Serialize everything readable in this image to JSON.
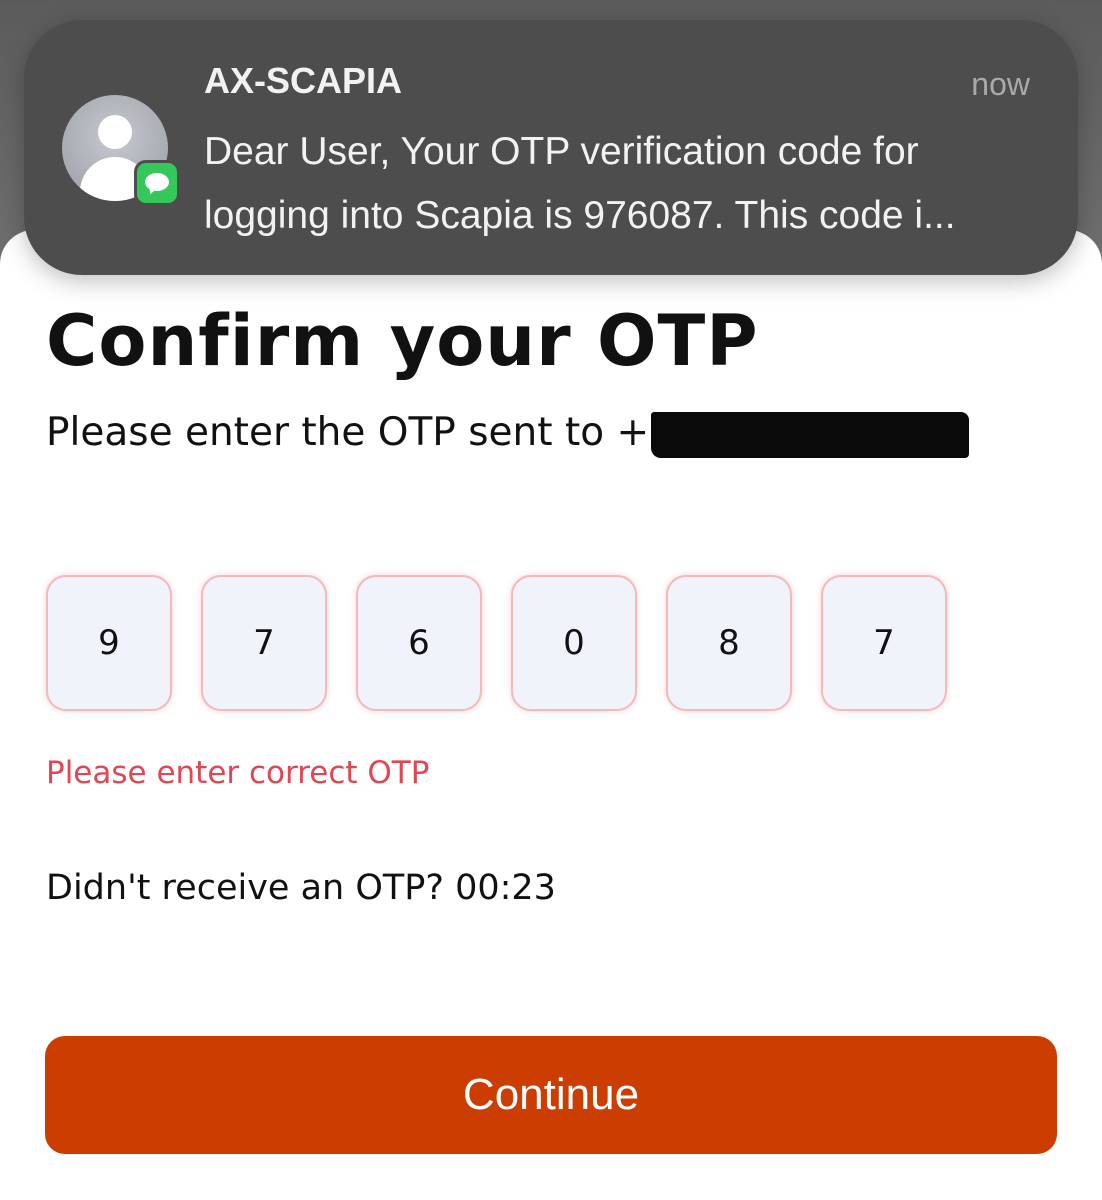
{
  "notification": {
    "sender": "AX-SCAPIA",
    "time": "now",
    "line1": "Dear User, Your OTP verification code for",
    "line2": "logging into Scapia is 976087. This code i..."
  },
  "page": {
    "title": "Confirm your OTP",
    "subtitle_prefix": "Please enter the OTP sent to +",
    "otp_digits": [
      "9",
      "7",
      "6",
      "0",
      "8",
      "7"
    ],
    "error_message": "Please enter correct OTP",
    "resend_text": "Didn't receive an OTP? 00:23",
    "continue_label": "Continue"
  },
  "colors": {
    "accent": "#cc3d02",
    "error": "#e24652",
    "otp_box_bg": "#f0f3fa",
    "otp_box_border": "#f3b9bd",
    "notification_bg": "#4d4d4d"
  },
  "icons": {
    "avatar": "person-avatar-icon",
    "badge": "messages-app-icon"
  }
}
